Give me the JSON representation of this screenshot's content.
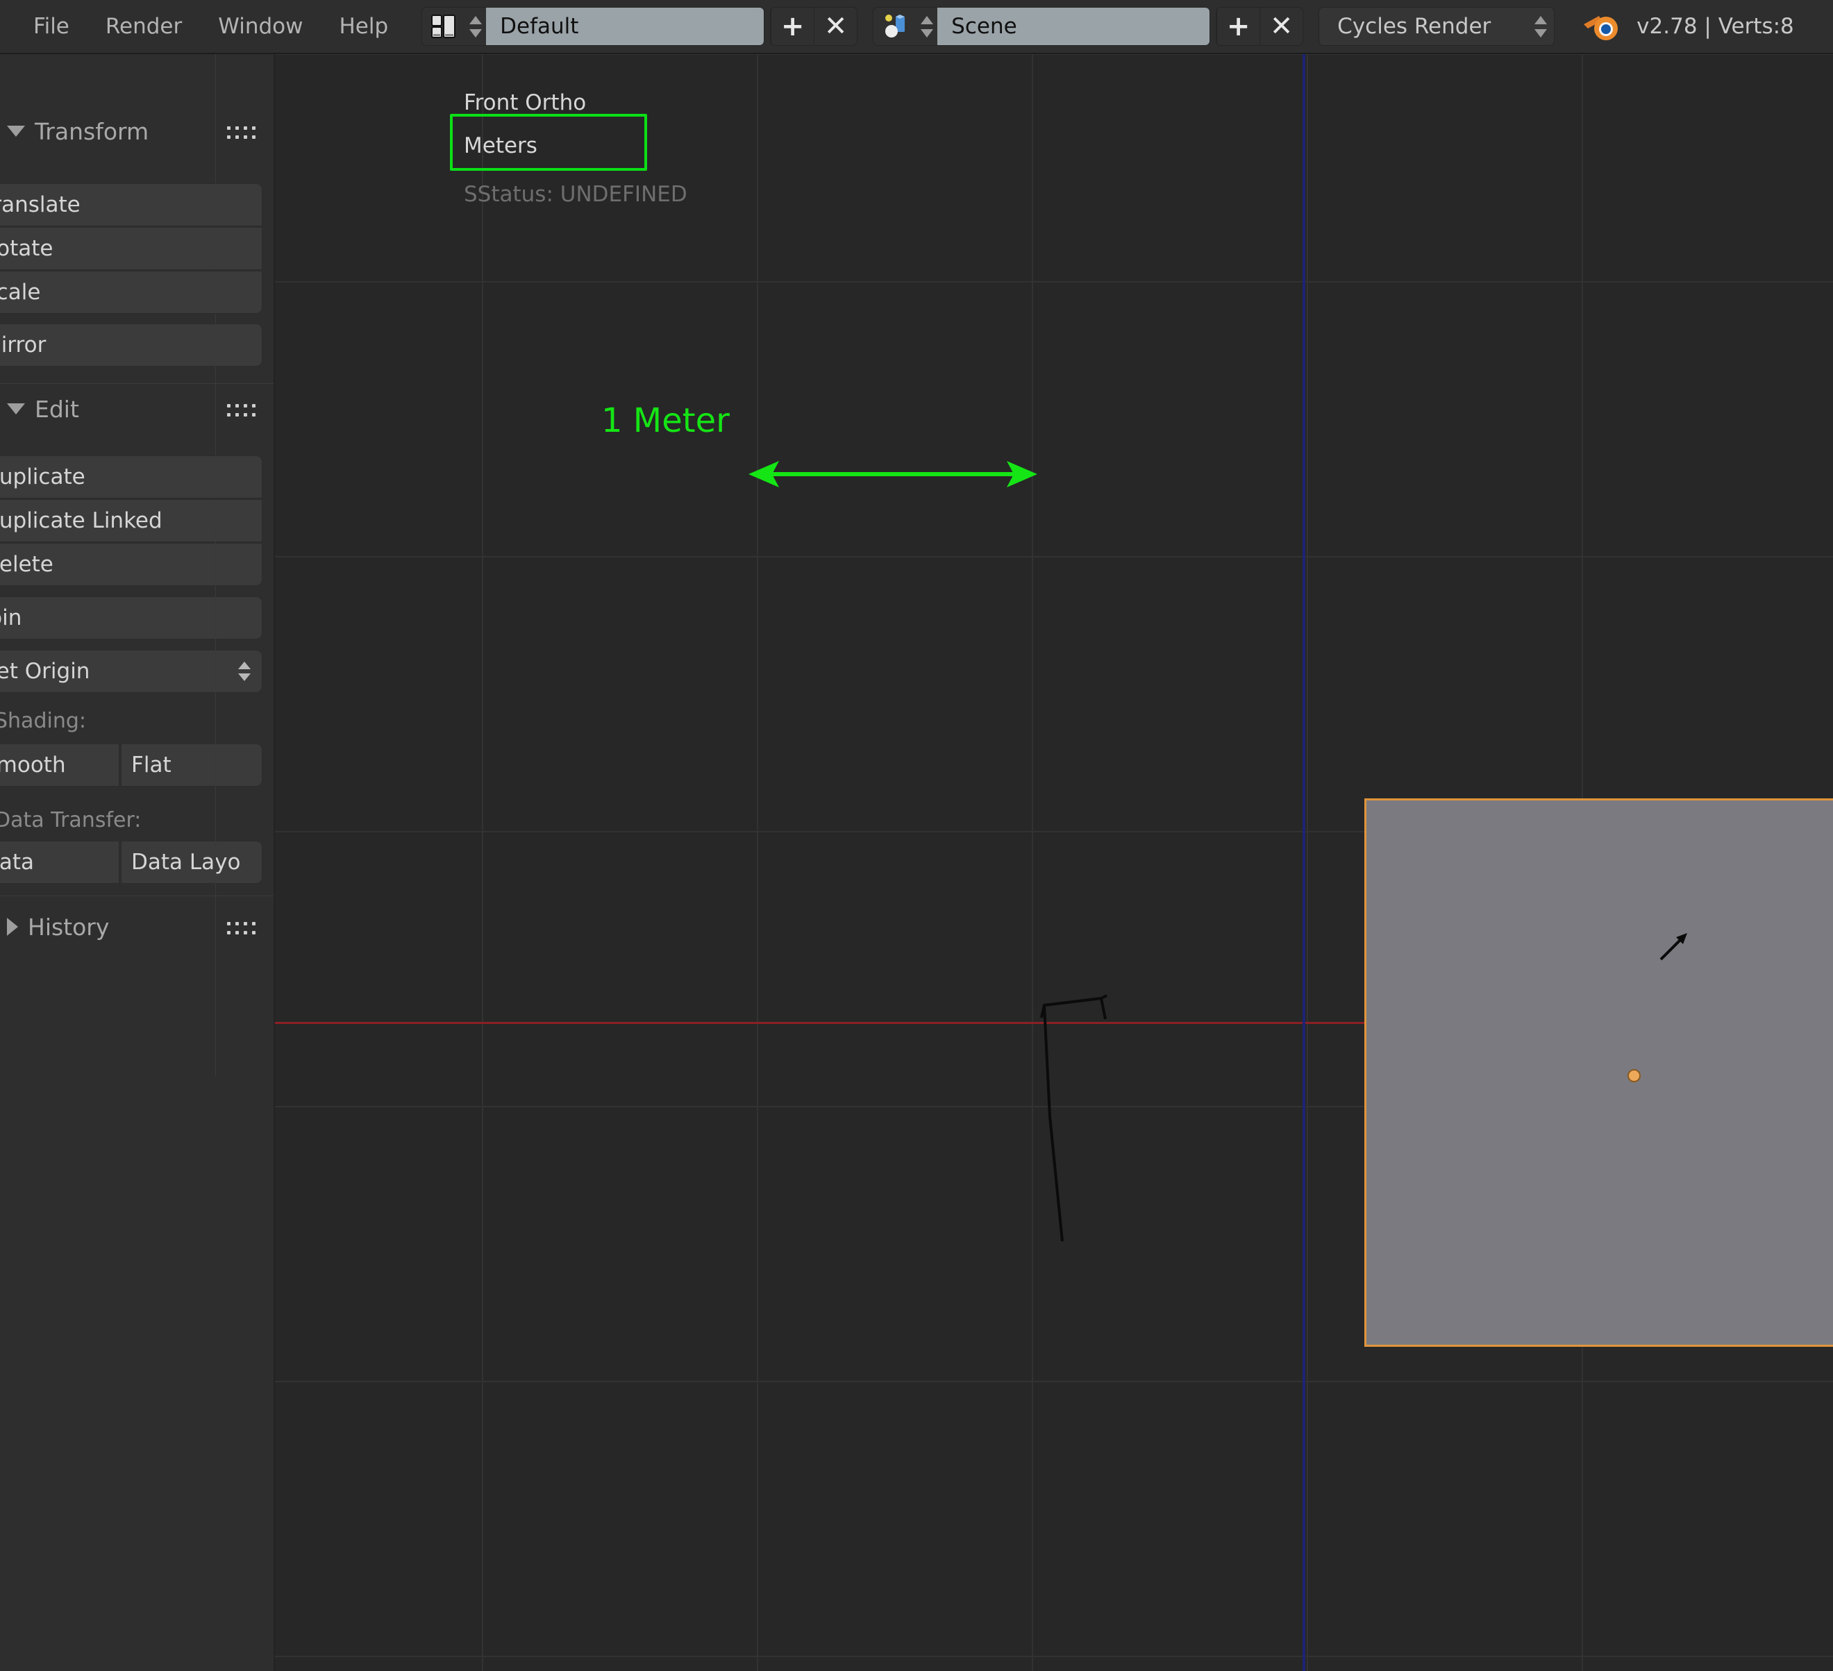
{
  "app": {
    "version_status": "v2.78 | Verts:8",
    "blender_icon": "blender-logo-icon"
  },
  "topbar": {
    "menus": [
      {
        "label": "File",
        "name": "menu-file"
      },
      {
        "label": "Render",
        "name": "menu-render"
      },
      {
        "label": "Window",
        "name": "menu-window"
      },
      {
        "label": "Help",
        "name": "menu-help"
      }
    ],
    "screen_layout": {
      "icon": "screen-layout-icon",
      "value": "Default",
      "add_label": "+",
      "remove_label": "✕"
    },
    "scene": {
      "icon": "scene-datablock-icon",
      "value": "Scene",
      "add_label": "+",
      "remove_label": "✕"
    },
    "engine": {
      "value": "Cycles Render"
    }
  },
  "toolshelf": {
    "panels": [
      {
        "name": "transform",
        "title": "Transform",
        "expanded": true,
        "buttons": [
          "Translate",
          "Rotate",
          "Scale",
          "Mirror"
        ]
      },
      {
        "name": "edit",
        "title": "Edit",
        "expanded": true,
        "buttons": [
          "Duplicate",
          "Duplicate Linked",
          "Delete",
          "Join",
          "Set Origin"
        ],
        "shading_label": "Shading:",
        "shading_buttons": [
          "Smooth",
          "Flat"
        ],
        "data_transfer_label": "Data Transfer:",
        "data_transfer_buttons": [
          "Data",
          "Data Layo"
        ]
      },
      {
        "name": "history",
        "title": "History",
        "expanded": false
      }
    ]
  },
  "viewport": {
    "view_name": "Front Ortho",
    "unit_label": "Meters",
    "status_line": "SStatus: UNDEFINED",
    "annotation": {
      "label": "1 Meter",
      "color": "#15e515"
    },
    "highlight_color": "#0bdf16",
    "selected_object_outline": "#e0953c",
    "object_fill": "#7b7a80",
    "axis_x_color": "#8c2025",
    "axis_z_color": "#1d2375",
    "grid_color": "#323232"
  }
}
